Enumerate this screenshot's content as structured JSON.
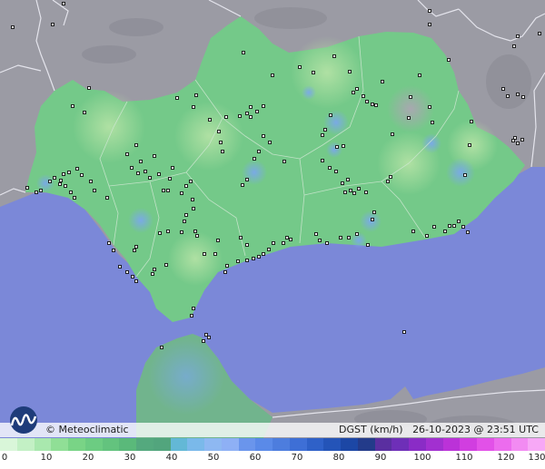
{
  "credit": "© Meteoclimatic",
  "variable": "DGST (km/h)",
  "datetime": "26-10-2023 @ 23:51 UTC",
  "colors": {
    "sea": "#7b88d8",
    "land_inside": "#74c989",
    "land_outside": "#9b9ba4",
    "border": "#dcdce6",
    "station": "#111111"
  },
  "scale": {
    "ticks": [
      "0",
      "10",
      "20",
      "30",
      "40",
      "50",
      "60",
      "70",
      "80",
      "90",
      "100",
      "110",
      "120",
      "130"
    ],
    "colors": [
      "#d9f6d9",
      "#c3f0c5",
      "#a9e8ae",
      "#90df96",
      "#79d486",
      "#6ccc82",
      "#63c37e",
      "#5ab97a",
      "#54a97e",
      "#52a57d",
      "#63b8d6",
      "#7ab9ea",
      "#8eb8f2",
      "#8eb0f5",
      "#6a95ec",
      "#5a8ae8",
      "#4d7dde",
      "#3e6fd6",
      "#2f61c8",
      "#2454b8",
      "#1c47a5",
      "#233b8a",
      "#5a2fa0",
      "#6e2fb8",
      "#8a2cc6",
      "#a230d0",
      "#bb32d8",
      "#d13ee0",
      "#e251e8",
      "#ec6cee",
      "#f28bf2",
      "#f7a8f6"
    ]
  }
}
